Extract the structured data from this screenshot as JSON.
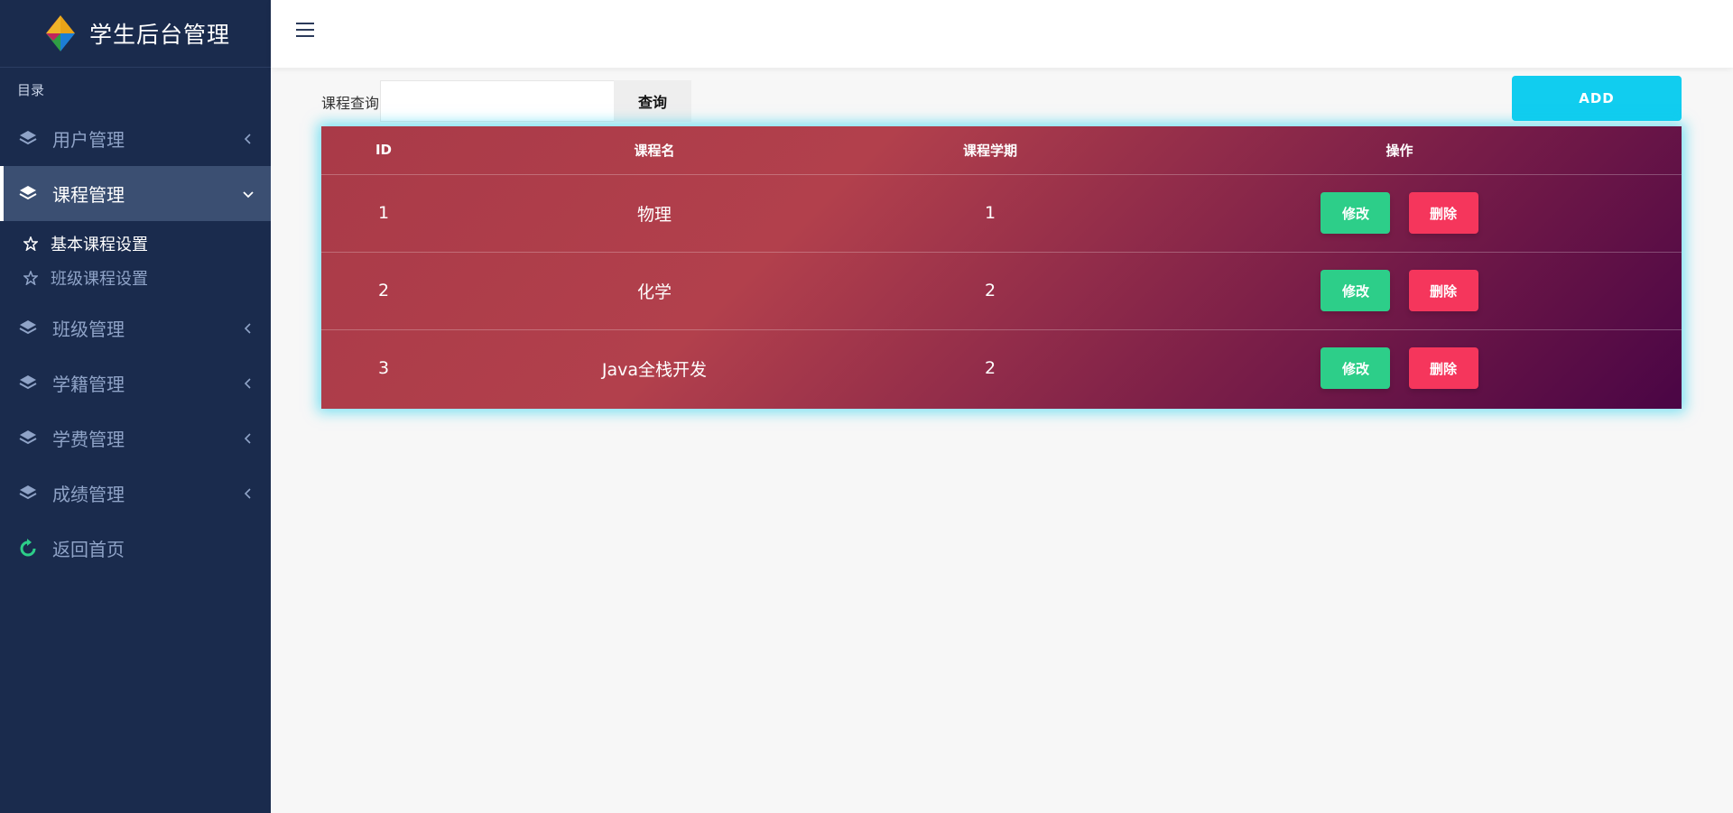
{
  "brand": {
    "title": "学生后台管理"
  },
  "sidebar": {
    "section_label": "目录",
    "items": [
      {
        "label": "用户管理",
        "icon": "layers-icon",
        "state": "collapsed"
      },
      {
        "label": "课程管理",
        "icon": "layers-icon",
        "state": "expanded",
        "active": true,
        "children": [
          {
            "label": "基本课程设置",
            "icon": "star-icon",
            "active": true
          },
          {
            "label": "班级课程设置",
            "icon": "star-icon",
            "active": false
          }
        ]
      },
      {
        "label": "班级管理",
        "icon": "layers-icon",
        "state": "collapsed"
      },
      {
        "label": "学籍管理",
        "icon": "layers-icon",
        "state": "collapsed"
      },
      {
        "label": "学费管理",
        "icon": "layers-icon",
        "state": "collapsed"
      },
      {
        "label": "成绩管理",
        "icon": "layers-icon",
        "state": "collapsed"
      },
      {
        "label": "返回首页",
        "icon": "refresh-icon"
      }
    ]
  },
  "search": {
    "label": "课程查询",
    "value": "",
    "placeholder": "",
    "button_label": "查询"
  },
  "toolbar": {
    "add_label": "ADD"
  },
  "table": {
    "headers": [
      "ID",
      "课程名",
      "课程学期",
      "操作"
    ],
    "rows": [
      {
        "id": "1",
        "name": "物理",
        "term": "1"
      },
      {
        "id": "2",
        "name": "化学",
        "term": "2"
      },
      {
        "id": "3",
        "name": "Java全栈开发",
        "term": "2"
      }
    ],
    "edit_label": "修改",
    "delete_label": "删除"
  },
  "colors": {
    "sidebar_bg": "#1a2b4d",
    "accent": "#11cdef",
    "edit": "#2dce89",
    "delete": "#f5365c"
  }
}
